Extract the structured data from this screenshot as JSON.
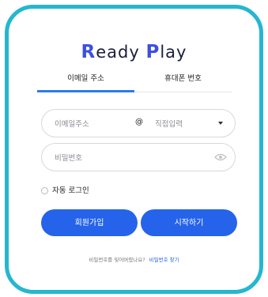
{
  "logo": {
    "r": "R",
    "eady": "eady",
    "p": "P",
    "lay": "lay"
  },
  "tabs": [
    {
      "label": "이메일 주소",
      "active": true
    },
    {
      "label": "휴대폰 번호",
      "active": false
    }
  ],
  "email_field": {
    "local_placeholder": "이메일주소",
    "at": "@",
    "domain_placeholder": "직접입력"
  },
  "password_field": {
    "placeholder": "비밀번호"
  },
  "auto_login": {
    "label": "자동 로그인",
    "checked": false
  },
  "buttons": {
    "signup": "회원가입",
    "start": "시작하기"
  },
  "footer": {
    "question": "비밀번호를 잊어버렸나요?",
    "link": "비밀번호 찾기"
  },
  "colors": {
    "frame": "#25b7cf",
    "primary": "#2563eb",
    "logo_accent": "#3d4fe0"
  },
  "icons": {
    "password_toggle": "eye-icon",
    "domain_select": "chevron-down-icon"
  }
}
